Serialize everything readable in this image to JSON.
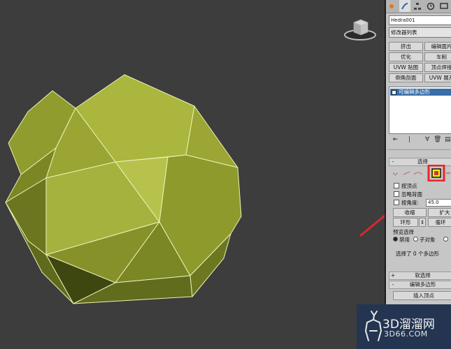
{
  "panel": {
    "object_name": "Hedra001",
    "modifier_list": "修改器列表",
    "modifier_buttons": [
      {
        "left": "挤出",
        "right": "编辑面片"
      },
      {
        "left": "优化",
        "right": "车削"
      },
      {
        "left": "UVW 贴图",
        "right": "顶点焊接"
      },
      {
        "left": "倒角剖面",
        "right": "UVW 展开"
      }
    ],
    "stack_item": "可编辑多边形",
    "selection": {
      "rollout_title": "选择",
      "by_vertex": "按顶点",
      "ignore_backfacing": "忽略背面",
      "by_angle": "按角度:",
      "angle_value": "45.0",
      "shrink": "收缩",
      "grow": "扩大",
      "ring": "环形",
      "loop": "循环",
      "preview_title": "预览选择",
      "preview_off": "禁用",
      "preview_subobject": "子对象",
      "status": "选择了 0 个多边形"
    },
    "soft_selection": "软选择",
    "edit_polygons": "编辑多边形",
    "insert_vertex": "插入顶点"
  },
  "watermark": {
    "brand": "3D溜溜网",
    "url": "3D66.COM"
  },
  "colors": {
    "viewport_bg": "#3d3d3d",
    "mesh_light": "#b7c24a",
    "mesh_dark": "#5c661c",
    "highlight": "#e8262a",
    "active_element": "#f5f500"
  }
}
